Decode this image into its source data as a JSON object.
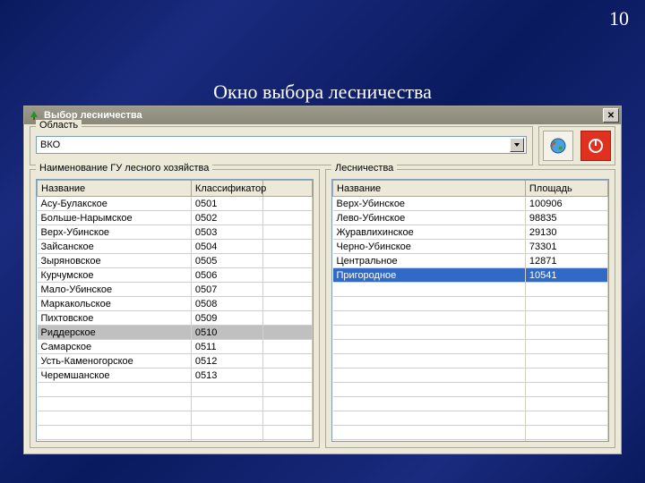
{
  "page_number": "10",
  "slide_title": "Окно выбора лесничества",
  "window": {
    "title": "Выбор лесничества",
    "close_glyph": "✕"
  },
  "region": {
    "group_label": "Область",
    "value": "ВКО"
  },
  "buttons": {
    "globe": "globe-icon",
    "power": "power-icon"
  },
  "left_panel": {
    "group_label": "Наименование ГУ лесного хозяйства",
    "col_name": "Название",
    "col_klass": "Классификатор",
    "rows": [
      {
        "name": "Асу-Булакское",
        "klass": "0501"
      },
      {
        "name": "Больше-Нарымское",
        "klass": "0502"
      },
      {
        "name": "Верх-Убинское",
        "klass": "0503"
      },
      {
        "name": "Зайсанское",
        "klass": "0504"
      },
      {
        "name": "Зыряновское",
        "klass": "0505"
      },
      {
        "name": "Курчумское",
        "klass": "0506"
      },
      {
        "name": "Мало-Убинское",
        "klass": "0507"
      },
      {
        "name": "Маркакольское",
        "klass": "0508"
      },
      {
        "name": "Пихтовское",
        "klass": "0509"
      },
      {
        "name": "Риддерское",
        "klass": "0510"
      },
      {
        "name": "Самарское",
        "klass": "0511"
      },
      {
        "name": "Усть-Каменогорское",
        "klass": "0512"
      },
      {
        "name": "Черемшанское",
        "klass": "0513"
      }
    ],
    "selected_index": 9
  },
  "right_panel": {
    "group_label": "Лесничества",
    "col_name": "Название",
    "col_area": "Площадь",
    "rows": [
      {
        "name": "Верх-Убинское",
        "area": "100906"
      },
      {
        "name": "Лево-Убинское",
        "area": "98835"
      },
      {
        "name": "Журавлихинское",
        "area": "29130"
      },
      {
        "name": "Черно-Убинское",
        "area": "73301"
      },
      {
        "name": "Центральное",
        "area": "12871"
      },
      {
        "name": "Пригородное",
        "area": "10541"
      }
    ],
    "selected_index": 5
  }
}
